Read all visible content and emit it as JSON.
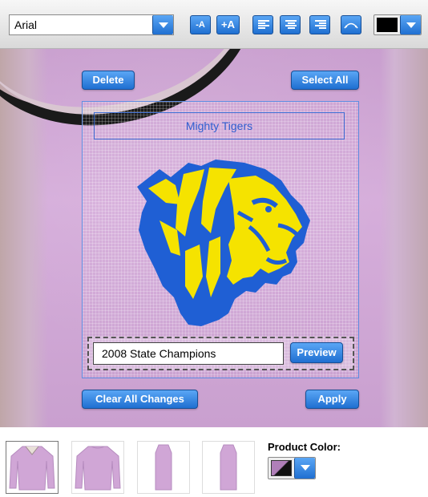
{
  "toolbar": {
    "font": {
      "selected": "Arial"
    },
    "buttons": {
      "decrease_font": "-A",
      "increase_font": "+A"
    },
    "text_color": "#000000"
  },
  "actions": {
    "delete": "Delete",
    "select_all": "Select All",
    "clear_all": "Clear All Changes",
    "apply": "Apply",
    "preview": "Preview"
  },
  "design": {
    "title_text": "Mighty Tigers",
    "caption_text": "2008 State Champions",
    "logo": "tiger-head-logo",
    "logo_colors": {
      "primary": "#1f5fd4",
      "secondary": "#f5e300"
    }
  },
  "bottom": {
    "product_color_label": "Product Color:",
    "product_color": "#b07fb9",
    "thumbnails": [
      "front-view",
      "back-view",
      "left-sleeve",
      "right-sleeve"
    ]
  }
}
